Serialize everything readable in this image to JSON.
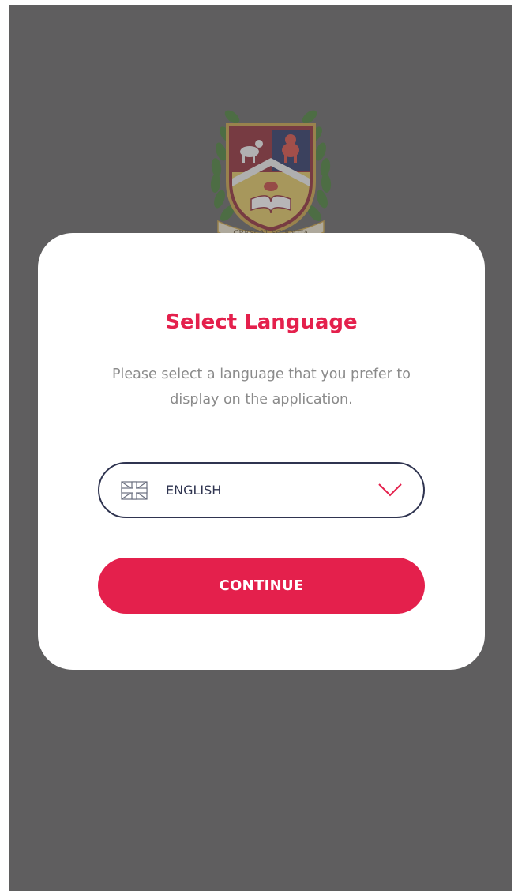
{
  "colors": {
    "backdrop": "#5f5e5f",
    "accent": "#e4204c",
    "navy": "#2f3450",
    "muted_text": "#8b8b8b",
    "card": "#ffffff"
  },
  "crest": {
    "motto": "CRESCAT SCIENTIA"
  },
  "modal": {
    "title": "Select Language",
    "description": "Please select a language that you prefer to display on the application.",
    "language_select": {
      "selected_value": "ENGLISH",
      "flag_icon": "uk-flag-icon",
      "dropdown_icon": "chevron-down-icon"
    },
    "continue_label": "CONTINUE"
  }
}
